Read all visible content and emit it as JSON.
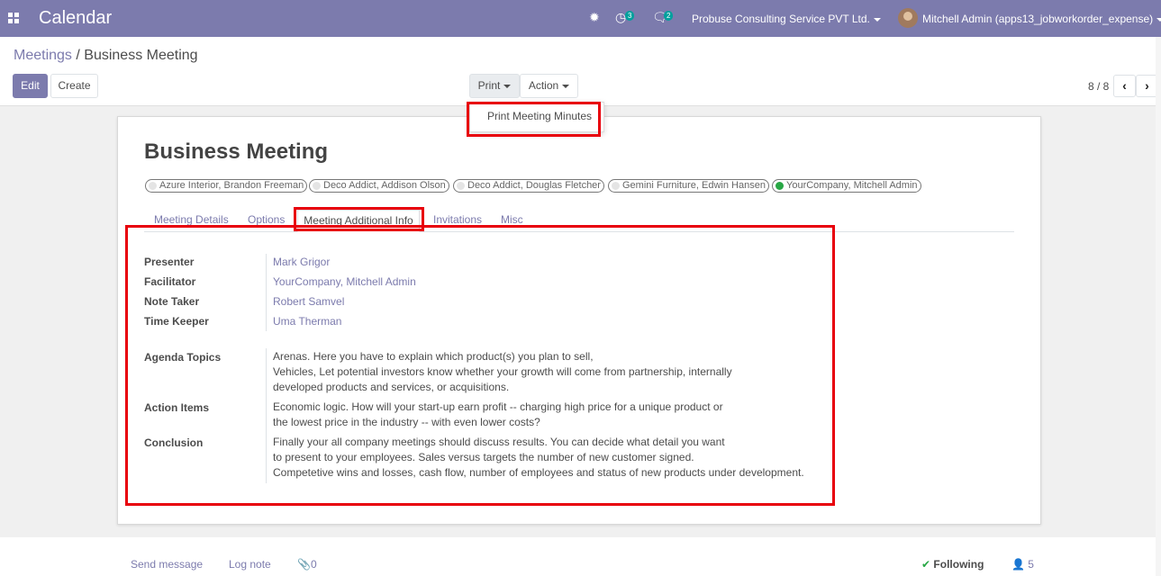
{
  "navbar": {
    "app_title": "Calendar",
    "activity_count": "3",
    "message_count": "2",
    "company": "Probuse Consulting Service PVT Ltd.",
    "user": "Mitchell Admin (apps13_jobworkorder_expense)",
    "bg_color": "#7c7bad"
  },
  "breadcrumb": {
    "parent": "Meetings",
    "separator": "/",
    "current": "Business Meeting"
  },
  "toolbar": {
    "edit_label": "Edit",
    "create_label": "Create",
    "print_label": "Print",
    "action_label": "Action"
  },
  "pager": {
    "value": "8 / 8"
  },
  "print_menu": {
    "items": [
      "Print Meeting Minutes"
    ]
  },
  "record": {
    "title": "Business Meeting",
    "attendees": [
      {
        "name": "Azure Interior, Brandon Freeman",
        "status": "grey"
      },
      {
        "name": "Deco Addict, Addison Olson",
        "status": "grey"
      },
      {
        "name": "Deco Addict, Douglas Fletcher",
        "status": "grey"
      },
      {
        "name": "Gemini Furniture, Edwin Hansen",
        "status": "grey"
      },
      {
        "name": "YourCompany, Mitchell Admin",
        "status": "green"
      }
    ]
  },
  "tabs": {
    "items": [
      "Meeting Details",
      "Options",
      "Meeting Additional Info",
      "Invitations",
      "Misc"
    ],
    "active": "Meeting Additional Info"
  },
  "fields": {
    "presenter": {
      "label": "Presenter",
      "value": "Mark Grigor"
    },
    "facilitator": {
      "label": "Facilitator",
      "value": "YourCompany, Mitchell Admin"
    },
    "note_taker": {
      "label": "Note Taker",
      "value": "Robert Samvel"
    },
    "time_keeper": {
      "label": "Time Keeper",
      "value": "Uma Therman"
    },
    "agenda_topics": {
      "label": "Agenda Topics",
      "value": "Arenas. Here you have to explain which product(s) you plan to sell,\nVehicles, Let potential investors know whether your growth will come from partnership, internally\ndeveloped products and services, or acquisitions."
    },
    "action_items": {
      "label": "Action Items",
      "value": "Economic logic. How will your start-up earn profit -- charging high price for a unique product or\nthe lowest price in the industry -- with even lower costs?"
    },
    "conclusion": {
      "label": "Conclusion",
      "value": "Finally your all company meetings should discuss results. You can decide what detail you want\nto present to your employees. Sales versus targets the number of new customer signed.\nCompetetive wins and losses, cash flow, number of employees and status of new products under development."
    }
  },
  "chatter": {
    "send_message": "Send message",
    "log_note": "Log note",
    "attachments": "0",
    "following": "Following",
    "followers": "5"
  },
  "highlight_color": "#e8000b"
}
